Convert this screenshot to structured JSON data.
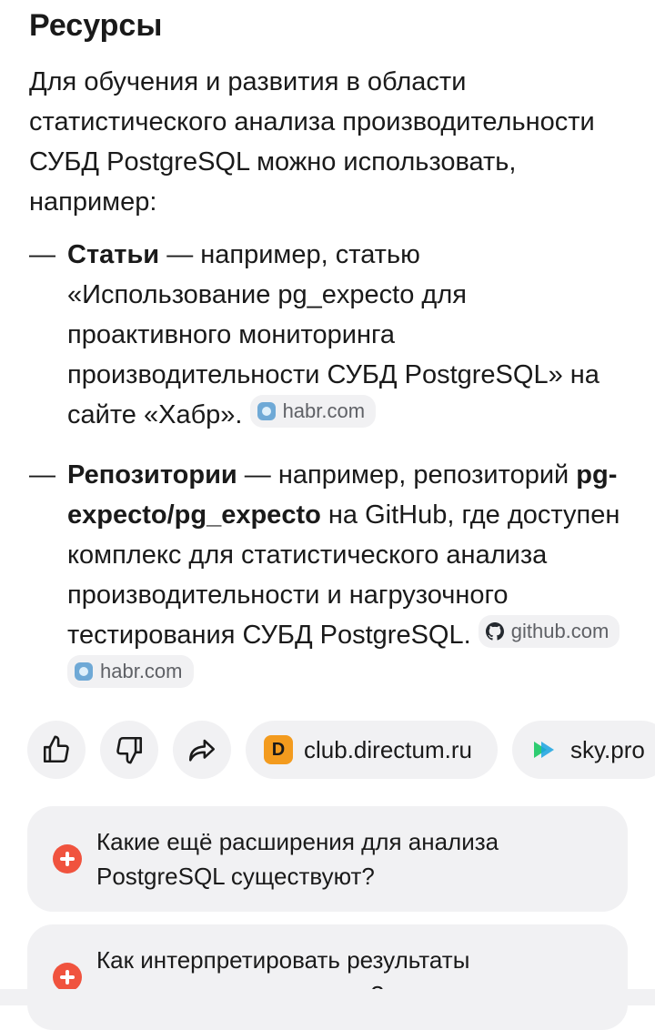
{
  "section": {
    "title": "Ресурсы",
    "intro": "Для обучения и развития в области статистического анализа производительности СУБД PostgreSQL можно использовать, например:"
  },
  "items": [
    {
      "dash": "—",
      "bold": "Статьи",
      "text": " — например, статью «Использование pg_expecto для проактивного мониторинга производительности СУБД PostgreSQL» на сайте «Хабр».",
      "chips": [
        {
          "label": "habr.com",
          "icon": "habr-icon"
        }
      ]
    },
    {
      "dash": "—",
      "bold": "Репозитории",
      "text_pre": " — например, репозиторий ",
      "bold2": "pg-expecto/pg_expecto",
      "text_post": " на GitHub, где доступен комплекс для статистического анализа производительности и нагрузочного тестирования СУБД PostgreSQL.",
      "chips": [
        {
          "label": "github.com",
          "icon": "github-icon"
        },
        {
          "label": "habr.com",
          "icon": "habr-icon"
        }
      ]
    }
  ],
  "actions": {
    "like_icon": "thumbs-up-icon",
    "dislike_icon": "thumbs-down-icon",
    "share_icon": "share-icon",
    "sources": [
      {
        "label": "club.directum.ru",
        "logo_letter": "D",
        "color": "#f39b1e"
      },
      {
        "label": "sky.pro",
        "color": "#2ecc71"
      }
    ]
  },
  "suggestions": [
    {
      "text": "Какие ещё расширения для анализа PostgreSQL существуют?"
    },
    {
      "text": "Как интерпретировать результаты статистического анализа?"
    }
  ],
  "colors": {
    "accent": "#f0533e",
    "chip_bg": "#f1f1f3"
  }
}
